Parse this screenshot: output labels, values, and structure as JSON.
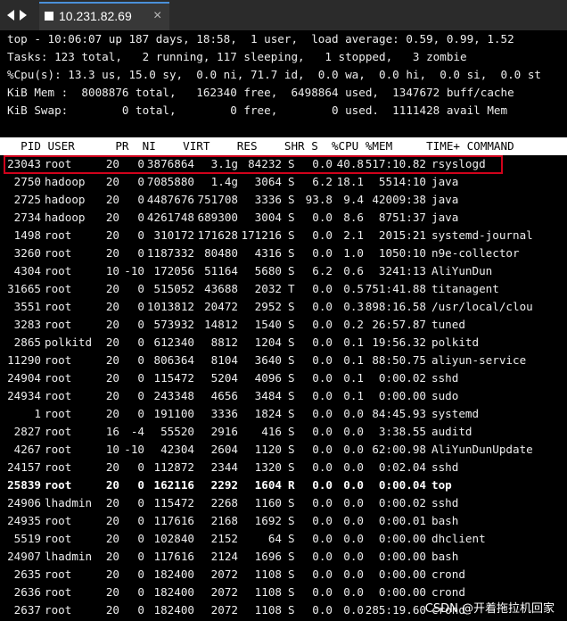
{
  "window": {
    "tab_title": "10.231.82.69"
  },
  "summary": {
    "line1": "top - 10:06:07 up 187 days, 18:58,  1 user,  load average: 0.59, 0.99, 1.52",
    "line2": "Tasks: 123 total,   2 running, 117 sleeping,   1 stopped,   3 zombie",
    "line3": "%Cpu(s): 13.3 us, 15.0 sy,  0.0 ni, 71.7 id,  0.0 wa,  0.0 hi,  0.0 si,  0.0 st",
    "line4": "KiB Mem :  8008876 total,   162340 free,  6498864 used,  1347672 buff/cache",
    "line5": "KiB Swap:        0 total,        0 free,        0 used.  1111428 avail Mem"
  },
  "table": {
    "header": "  PID USER      PR  NI    VIRT    RES    SHR S  %CPU %MEM     TIME+ COMMAND",
    "rows": [
      {
        "pid": "23043",
        "user": "root",
        "pr": "20",
        "ni": "0",
        "virt": "3876864",
        "res": "3.1g",
        "shr": "84232",
        "s": "S",
        "cpu": "0.0",
        "mem": "40.8",
        "time": "517:10.82",
        "cmd": "rsyslogd"
      },
      {
        "pid": "2750",
        "user": "hadoop",
        "pr": "20",
        "ni": "0",
        "virt": "7085880",
        "res": "1.4g",
        "shr": "3064",
        "s": "S",
        "cpu": "6.2",
        "mem": "18.1",
        "time": "5514:10",
        "cmd": "java"
      },
      {
        "pid": "2725",
        "user": "hadoop",
        "pr": "20",
        "ni": "0",
        "virt": "4487676",
        "res": "751708",
        "shr": "3336",
        "s": "S",
        "cpu": "93.8",
        "mem": "9.4",
        "time": "42009:38",
        "cmd": "java"
      },
      {
        "pid": "2734",
        "user": "hadoop",
        "pr": "20",
        "ni": "0",
        "virt": "4261748",
        "res": "689300",
        "shr": "3004",
        "s": "S",
        "cpu": "0.0",
        "mem": "8.6",
        "time": "8751:37",
        "cmd": "java"
      },
      {
        "pid": "1498",
        "user": "root",
        "pr": "20",
        "ni": "0",
        "virt": "310172",
        "res": "171628",
        "shr": "171216",
        "s": "S",
        "cpu": "0.0",
        "mem": "2.1",
        "time": "2015:21",
        "cmd": "systemd-journal"
      },
      {
        "pid": "3260",
        "user": "root",
        "pr": "20",
        "ni": "0",
        "virt": "1187332",
        "res": "80480",
        "shr": "4316",
        "s": "S",
        "cpu": "0.0",
        "mem": "1.0",
        "time": "1050:10",
        "cmd": "n9e-collector"
      },
      {
        "pid": "4304",
        "user": "root",
        "pr": "10",
        "ni": "-10",
        "virt": "172056",
        "res": "51164",
        "shr": "5680",
        "s": "S",
        "cpu": "6.2",
        "mem": "0.6",
        "time": "3241:13",
        "cmd": "AliYunDun"
      },
      {
        "pid": "31665",
        "user": "root",
        "pr": "20",
        "ni": "0",
        "virt": "515052",
        "res": "43688",
        "shr": "2032",
        "s": "T",
        "cpu": "0.0",
        "mem": "0.5",
        "time": "751:41.88",
        "cmd": "titanagent"
      },
      {
        "pid": "3551",
        "user": "root",
        "pr": "20",
        "ni": "0",
        "virt": "1013812",
        "res": "20472",
        "shr": "2952",
        "s": "S",
        "cpu": "0.0",
        "mem": "0.3",
        "time": "898:16.58",
        "cmd": "/usr/local/clou"
      },
      {
        "pid": "3283",
        "user": "root",
        "pr": "20",
        "ni": "0",
        "virt": "573932",
        "res": "14812",
        "shr": "1540",
        "s": "S",
        "cpu": "0.0",
        "mem": "0.2",
        "time": "26:57.87",
        "cmd": "tuned"
      },
      {
        "pid": "2865",
        "user": "polkitd",
        "pr": "20",
        "ni": "0",
        "virt": "612340",
        "res": "8812",
        "shr": "1204",
        "s": "S",
        "cpu": "0.0",
        "mem": "0.1",
        "time": "19:56.32",
        "cmd": "polkitd"
      },
      {
        "pid": "11290",
        "user": "root",
        "pr": "20",
        "ni": "0",
        "virt": "806364",
        "res": "8104",
        "shr": "3640",
        "s": "S",
        "cpu": "0.0",
        "mem": "0.1",
        "time": "88:50.75",
        "cmd": "aliyun-service"
      },
      {
        "pid": "24904",
        "user": "root",
        "pr": "20",
        "ni": "0",
        "virt": "115472",
        "res": "5204",
        "shr": "4096",
        "s": "S",
        "cpu": "0.0",
        "mem": "0.1",
        "time": "0:00.02",
        "cmd": "sshd"
      },
      {
        "pid": "24934",
        "user": "root",
        "pr": "20",
        "ni": "0",
        "virt": "243348",
        "res": "4656",
        "shr": "3484",
        "s": "S",
        "cpu": "0.0",
        "mem": "0.1",
        "time": "0:00.00",
        "cmd": "sudo"
      },
      {
        "pid": "1",
        "user": "root",
        "pr": "20",
        "ni": "0",
        "virt": "191100",
        "res": "3336",
        "shr": "1824",
        "s": "S",
        "cpu": "0.0",
        "mem": "0.0",
        "time": "84:45.93",
        "cmd": "systemd"
      },
      {
        "pid": "2827",
        "user": "root",
        "pr": "16",
        "ni": "-4",
        "virt": "55520",
        "res": "2916",
        "shr": "416",
        "s": "S",
        "cpu": "0.0",
        "mem": "0.0",
        "time": "3:38.55",
        "cmd": "auditd"
      },
      {
        "pid": "4267",
        "user": "root",
        "pr": "10",
        "ni": "-10",
        "virt": "42304",
        "res": "2604",
        "shr": "1120",
        "s": "S",
        "cpu": "0.0",
        "mem": "0.0",
        "time": "62:00.98",
        "cmd": "AliYunDunUpdate"
      },
      {
        "pid": "24157",
        "user": "root",
        "pr": "20",
        "ni": "0",
        "virt": "112872",
        "res": "2344",
        "shr": "1320",
        "s": "S",
        "cpu": "0.0",
        "mem": "0.0",
        "time": "0:02.04",
        "cmd": "sshd"
      },
      {
        "pid": "25839",
        "user": "root",
        "pr": "20",
        "ni": "0",
        "virt": "162116",
        "res": "2292",
        "shr": "1604",
        "s": "R",
        "cpu": "0.0",
        "mem": "0.0",
        "time": "0:00.04",
        "cmd": "top"
      },
      {
        "pid": "24906",
        "user": "lhadmin",
        "pr": "20",
        "ni": "0",
        "virt": "115472",
        "res": "2268",
        "shr": "1160",
        "s": "S",
        "cpu": "0.0",
        "mem": "0.0",
        "time": "0:00.02",
        "cmd": "sshd"
      },
      {
        "pid": "24935",
        "user": "root",
        "pr": "20",
        "ni": "0",
        "virt": "117616",
        "res": "2168",
        "shr": "1692",
        "s": "S",
        "cpu": "0.0",
        "mem": "0.0",
        "time": "0:00.01",
        "cmd": "bash"
      },
      {
        "pid": "5519",
        "user": "root",
        "pr": "20",
        "ni": "0",
        "virt": "102840",
        "res": "2152",
        "shr": "64",
        "s": "S",
        "cpu": "0.0",
        "mem": "0.0",
        "time": "0:00.00",
        "cmd": "dhclient"
      },
      {
        "pid": "24907",
        "user": "lhadmin",
        "pr": "20",
        "ni": "0",
        "virt": "117616",
        "res": "2124",
        "shr": "1696",
        "s": "S",
        "cpu": "0.0",
        "mem": "0.0",
        "time": "0:00.00",
        "cmd": "bash"
      },
      {
        "pid": "2635",
        "user": "root",
        "pr": "20",
        "ni": "0",
        "virt": "182400",
        "res": "2072",
        "shr": "1108",
        "s": "S",
        "cpu": "0.0",
        "mem": "0.0",
        "time": "0:00.00",
        "cmd": "crond"
      },
      {
        "pid": "2636",
        "user": "root",
        "pr": "20",
        "ni": "0",
        "virt": "182400",
        "res": "2072",
        "shr": "1108",
        "s": "S",
        "cpu": "0.0",
        "mem": "0.0",
        "time": "0:00.00",
        "cmd": "crond"
      },
      {
        "pid": "2637",
        "user": "root",
        "pr": "20",
        "ni": "0",
        "virt": "182400",
        "res": "2072",
        "shr": "1108",
        "s": "S",
        "cpu": "0.0",
        "mem": "0.0",
        "time": "285:19.60",
        "cmd": "crond"
      }
    ]
  },
  "watermark": "CSDN @开着拖拉机回家",
  "colors": {
    "highlight_border": "#d0021b",
    "terminal_bg": "#000000",
    "terminal_fg": "#ededed"
  }
}
